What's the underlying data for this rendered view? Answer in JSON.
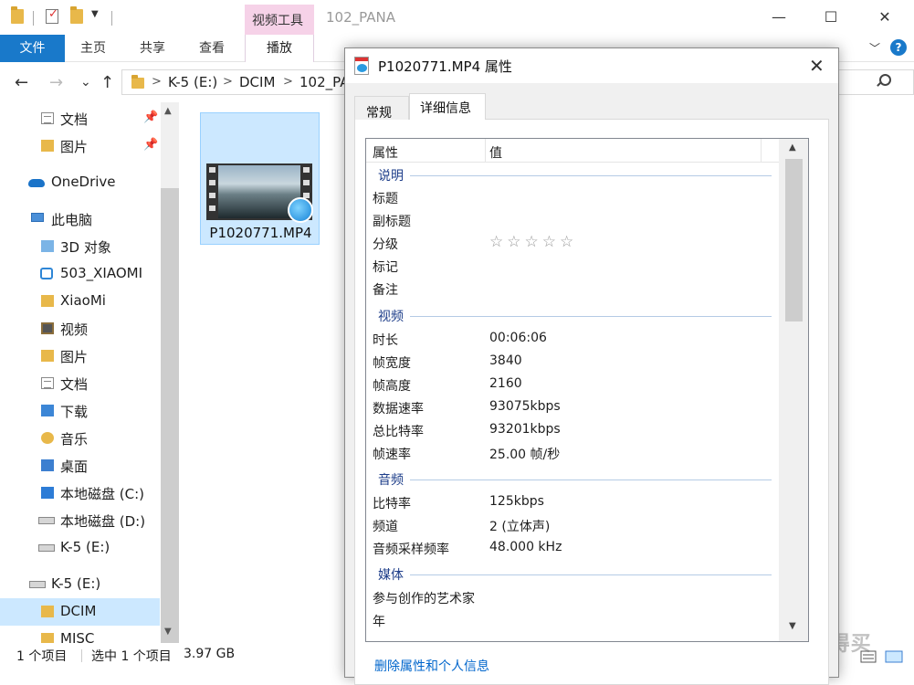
{
  "titlebar": {
    "tool_context_label": "视频工具",
    "folder_title": "102_PANA",
    "minimize_glyph": "—",
    "maximize_glyph": "☐",
    "close_glyph": "✕",
    "dropdown_glyph": "▼"
  },
  "ribbon": {
    "file_tab": "文件",
    "tabs": [
      "主页",
      "共享",
      "查看"
    ],
    "play_tab": "播放",
    "chevron_glyph": "﹀",
    "help_glyph": "?"
  },
  "address": {
    "back_glyph": "←",
    "forward_glyph": "→",
    "recent_glyph": "⌄",
    "up_glyph": "↑",
    "separator_glyph": ">",
    "breadcrumbs": [
      "K-5 (E:)",
      "DCIM",
      "102_PA"
    ]
  },
  "nav": {
    "items": [
      {
        "label": "文档",
        "icon": "documents-icon",
        "pinned": true
      },
      {
        "label": "图片",
        "icon": "pictures-icon",
        "pinned": true
      },
      {
        "label": "OneDrive",
        "icon": "onedrive-icon"
      },
      {
        "label": "此电脑",
        "icon": "this-pc-icon"
      },
      {
        "label": "3D 对象",
        "icon": "3d-objects-icon"
      },
      {
        "label": "503_XIAOMI",
        "icon": "network-drive-icon"
      },
      {
        "label": "XiaoMi",
        "icon": "folder-icon"
      },
      {
        "label": "视频",
        "icon": "videos-icon"
      },
      {
        "label": "图片",
        "icon": "pictures-icon"
      },
      {
        "label": "文档",
        "icon": "documents-icon"
      },
      {
        "label": "下载",
        "icon": "downloads-icon"
      },
      {
        "label": "音乐",
        "icon": "music-icon"
      },
      {
        "label": "桌面",
        "icon": "desktop-icon"
      },
      {
        "label": "本地磁盘 (C:)",
        "icon": "windows-drive-icon"
      },
      {
        "label": "本地磁盘 (D:)",
        "icon": "drive-icon"
      },
      {
        "label": "K-5 (E:)",
        "icon": "drive-icon"
      },
      {
        "label": "K-5 (E:)",
        "icon": "drive-icon"
      },
      {
        "label": "DCIM",
        "icon": "folder-icon",
        "selected": true
      },
      {
        "label": "MISC",
        "icon": "folder-icon"
      }
    ],
    "pin_glyph": "📌"
  },
  "content": {
    "file_name": "P1020771.MP4"
  },
  "status": {
    "item_count": "1 个项目",
    "selection": "选中 1 个项目",
    "size": "3.97 GB"
  },
  "watermark": "值 什么值得买",
  "dialog": {
    "title": "P1020771.MP4 属性",
    "close_glyph": "✕",
    "tabs": {
      "general": "常规",
      "details": "详细信息"
    },
    "columns": {
      "property": "属性",
      "value": "值"
    },
    "groups": {
      "description": "说明",
      "video": "视频",
      "audio": "音频",
      "media": "媒体"
    },
    "description_rows": [
      {
        "k": "标题",
        "v": ""
      },
      {
        "k": "副标题",
        "v": ""
      },
      {
        "k": "分级",
        "v": "☆☆☆☆☆"
      },
      {
        "k": "标记",
        "v": ""
      },
      {
        "k": "备注",
        "v": ""
      }
    ],
    "video_rows": [
      {
        "k": "时长",
        "v": "00:06:06"
      },
      {
        "k": "帧宽度",
        "v": "3840"
      },
      {
        "k": "帧高度",
        "v": "2160"
      },
      {
        "k": "数据速率",
        "v": "93075kbps"
      },
      {
        "k": "总比特率",
        "v": "93201kbps"
      },
      {
        "k": "帧速率",
        "v": "25.00 帧/秒"
      }
    ],
    "audio_rows": [
      {
        "k": "比特率",
        "v": "125kbps"
      },
      {
        "k": "频道",
        "v": "2 (立体声)"
      },
      {
        "k": "音频采样频率",
        "v": "48.000 kHz"
      }
    ],
    "media_rows": [
      {
        "k": "参与创作的艺术家",
        "v": ""
      },
      {
        "k": "年",
        "v": ""
      }
    ],
    "scroll_up_glyph": "▲",
    "scroll_down_glyph": "▼",
    "remove_link": "删除属性和个人信息"
  }
}
